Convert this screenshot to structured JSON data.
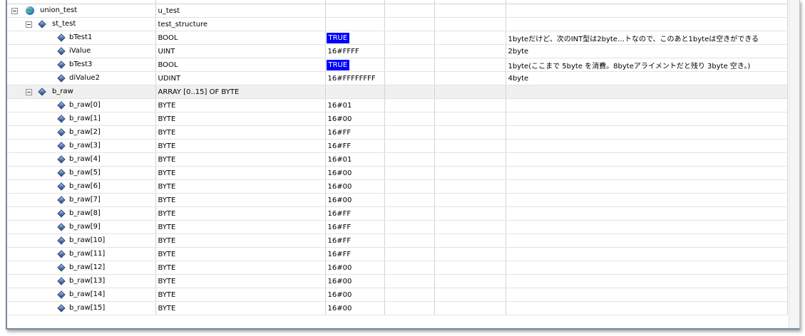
{
  "rows": [
    {
      "name": "union_test",
      "type": "u_test",
      "value": "",
      "comment": "",
      "icon": "globe-icon",
      "expander": true,
      "level": 0
    },
    {
      "name": "st_test",
      "type": "test_structure",
      "value": "",
      "comment": "",
      "icon": "variable-icon",
      "expander": true,
      "level": 1
    },
    {
      "name": "bTest1",
      "type": "BOOL",
      "value": "TRUE",
      "comment": "1byteだけど、次のINT型は2byte…トなので、このあと1byteは空きができる",
      "icon": "variable-icon",
      "highlight": true,
      "level": 2
    },
    {
      "name": "iValue",
      "type": "UINT",
      "value": "16#FFFF",
      "comment": "2byte",
      "icon": "variable-icon",
      "level": 2
    },
    {
      "name": "bTest3",
      "type": "BOOL",
      "value": "TRUE",
      "comment": "1byte(ここまで 5byte を消費。8byteアライメントだと残り 3byte 空き。)",
      "icon": "variable-icon",
      "highlight": true,
      "level": 2
    },
    {
      "name": "diValue2",
      "type": "UDINT",
      "value": "16#FFFFFFFF",
      "comment": "4byte",
      "icon": "variable-icon",
      "level": 2
    },
    {
      "name": "b_raw",
      "type": "ARRAY [0..15] OF BYTE",
      "value": "",
      "comment": "",
      "icon": "variable-icon",
      "expander": true,
      "level": 1,
      "grey": true
    },
    {
      "name": "b_raw[0]",
      "type": "BYTE",
      "value": "16#01",
      "comment": "",
      "icon": "variable-icon",
      "level": 2
    },
    {
      "name": "b_raw[1]",
      "type": "BYTE",
      "value": "16#00",
      "comment": "",
      "icon": "variable-icon",
      "level": 2
    },
    {
      "name": "b_raw[2]",
      "type": "BYTE",
      "value": "16#FF",
      "comment": "",
      "icon": "variable-icon",
      "level": 2
    },
    {
      "name": "b_raw[3]",
      "type": "BYTE",
      "value": "16#FF",
      "comment": "",
      "icon": "variable-icon",
      "level": 2
    },
    {
      "name": "b_raw[4]",
      "type": "BYTE",
      "value": "16#01",
      "comment": "",
      "icon": "variable-icon",
      "level": 2
    },
    {
      "name": "b_raw[5]",
      "type": "BYTE",
      "value": "16#00",
      "comment": "",
      "icon": "variable-icon",
      "level": 2
    },
    {
      "name": "b_raw[6]",
      "type": "BYTE",
      "value": "16#00",
      "comment": "",
      "icon": "variable-icon",
      "level": 2
    },
    {
      "name": "b_raw[7]",
      "type": "BYTE",
      "value": "16#00",
      "comment": "",
      "icon": "variable-icon",
      "level": 2
    },
    {
      "name": "b_raw[8]",
      "type": "BYTE",
      "value": "16#FF",
      "comment": "",
      "icon": "variable-icon",
      "level": 2
    },
    {
      "name": "b_raw[9]",
      "type": "BYTE",
      "value": "16#FF",
      "comment": "",
      "icon": "variable-icon",
      "level": 2
    },
    {
      "name": "b_raw[10]",
      "type": "BYTE",
      "value": "16#FF",
      "comment": "",
      "icon": "variable-icon",
      "level": 2
    },
    {
      "name": "b_raw[11]",
      "type": "BYTE",
      "value": "16#FF",
      "comment": "",
      "icon": "variable-icon",
      "level": 2
    },
    {
      "name": "b_raw[12]",
      "type": "BYTE",
      "value": "16#00",
      "comment": "",
      "icon": "variable-icon",
      "level": 2
    },
    {
      "name": "b_raw[13]",
      "type": "BYTE",
      "value": "16#00",
      "comment": "",
      "icon": "variable-icon",
      "level": 2
    },
    {
      "name": "b_raw[14]",
      "type": "BYTE",
      "value": "16#00",
      "comment": "",
      "icon": "variable-icon",
      "level": 2
    },
    {
      "name": "b_raw[15]",
      "type": "BYTE",
      "value": "16#00",
      "comment": "",
      "icon": "variable-icon",
      "level": 2
    }
  ],
  "colors": {
    "true_badge_bg": "#0000ff",
    "true_badge_fg": "#ffffff",
    "grid_line": "#d4d4d4",
    "grey_row": "#f0f0f0"
  }
}
